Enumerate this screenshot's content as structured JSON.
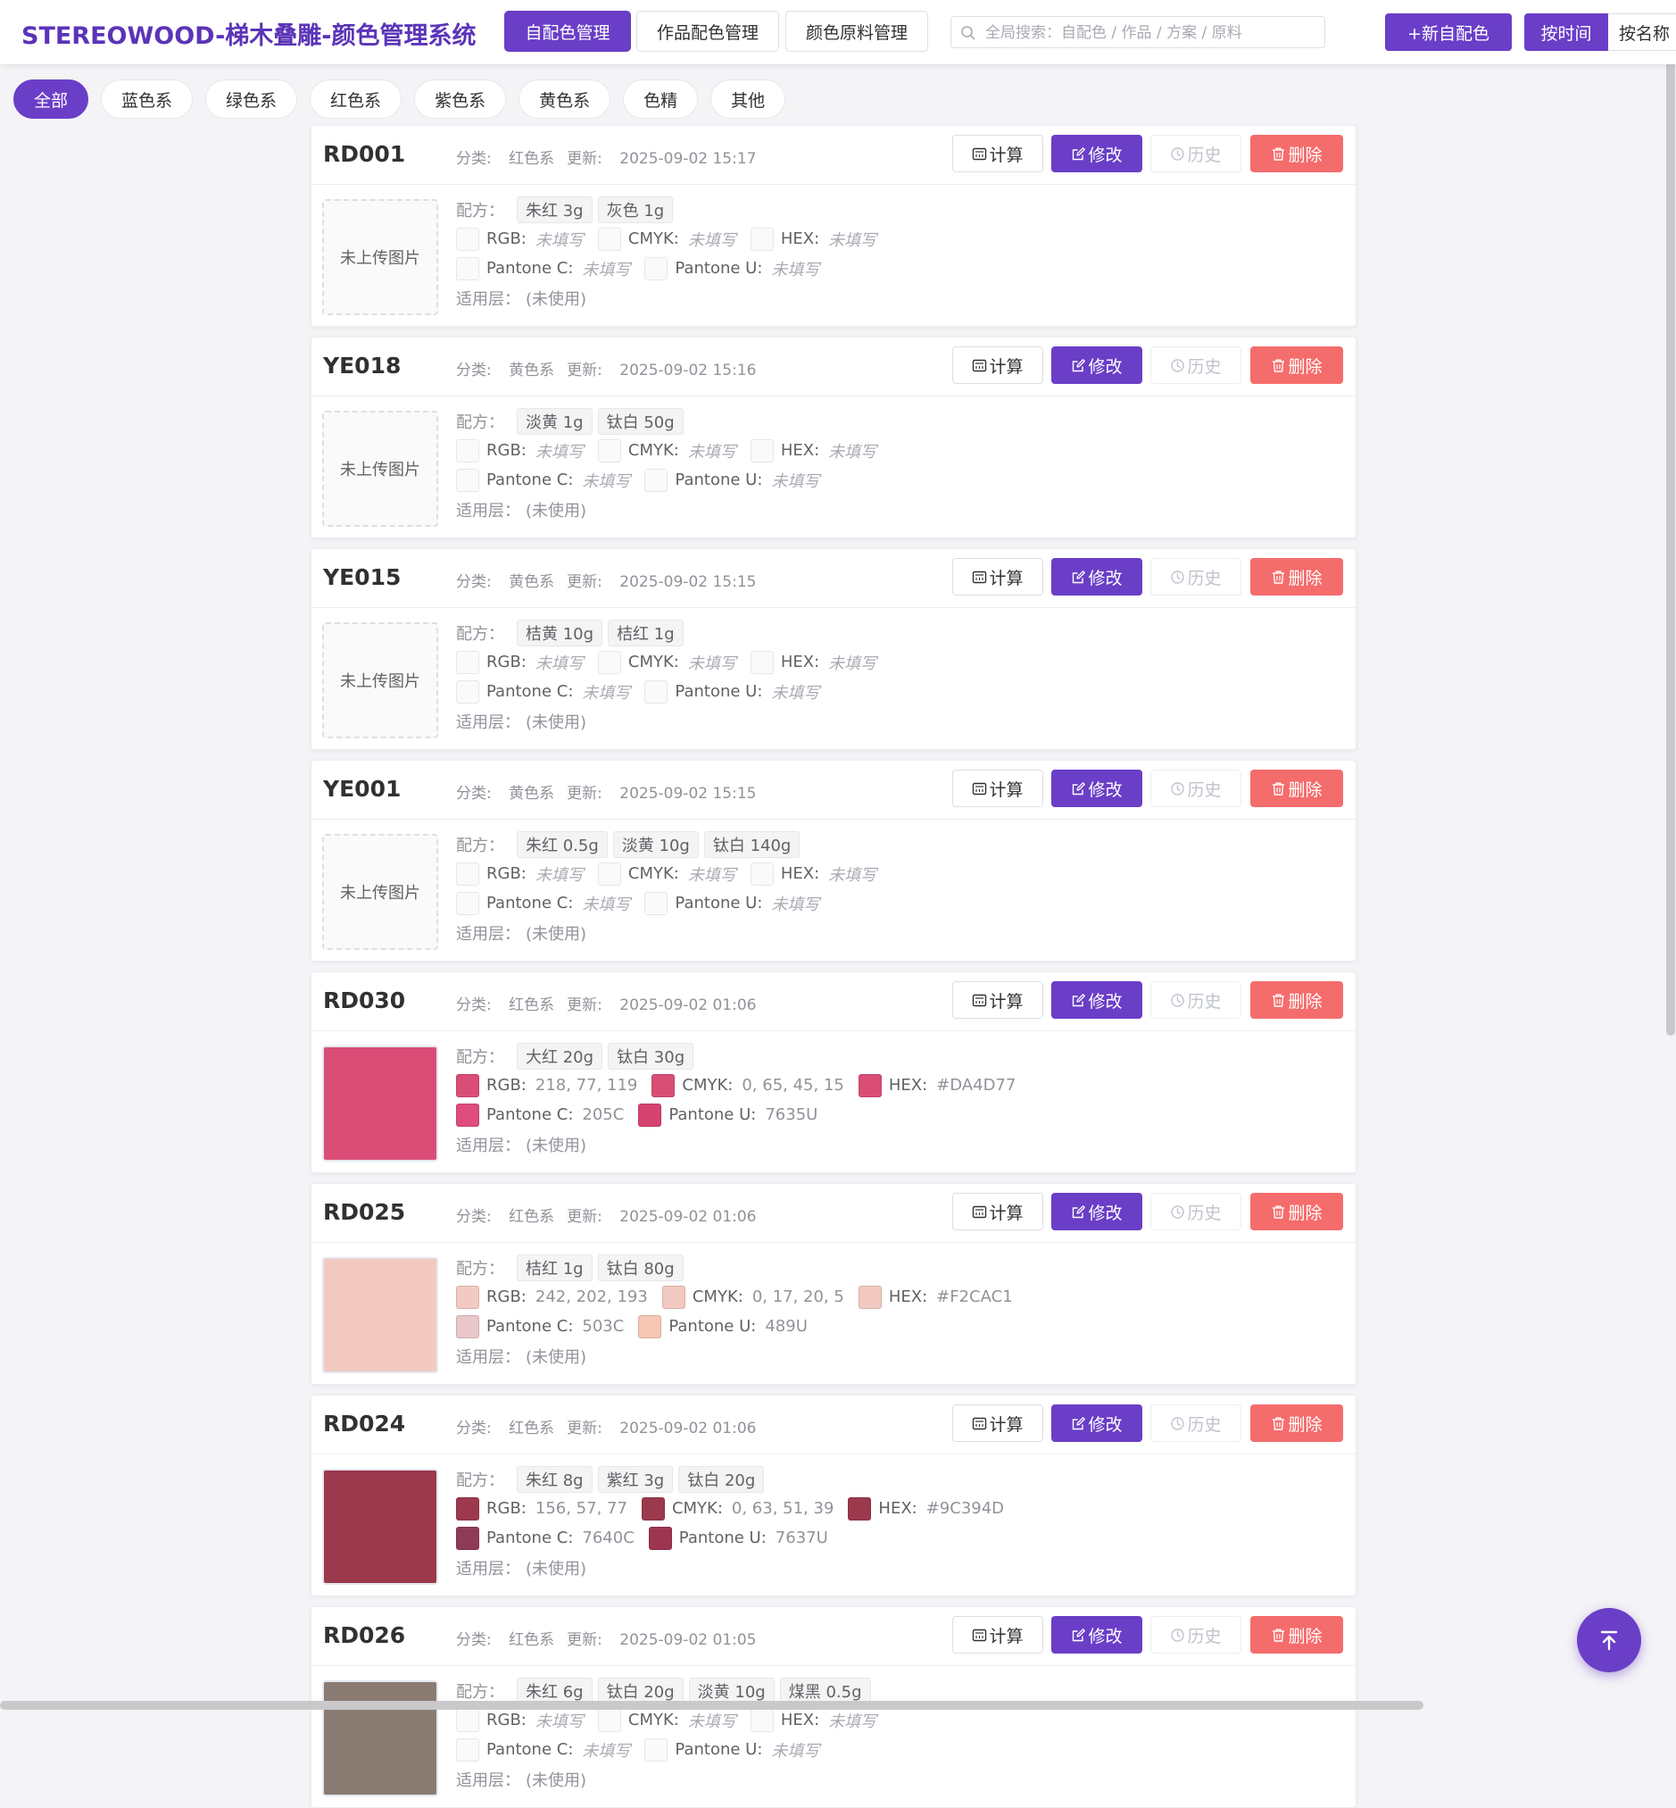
{
  "header": {
    "title": "STEREOWOOD-梯木叠雕-颜色管理系统",
    "tabs": [
      "自配色管理",
      "作品配色管理",
      "颜色原料管理"
    ],
    "search_placeholder": "全局搜索：自配色 / 作品 / 方案 / 原料",
    "new_button": "+新自配色",
    "sort_time": "按时间",
    "sort_name": "按名称"
  },
  "filters": [
    "全部",
    "蓝色系",
    "绿色系",
    "红色系",
    "紫色系",
    "黄色系",
    "色精",
    "其他"
  ],
  "labels": {
    "category": "分类:",
    "updated": "更新:",
    "calc": "计算",
    "edit": "修改",
    "history": "历史",
    "delete": "删除",
    "formula": "配方：",
    "layer": "适用层：",
    "no_image": "未上传图片",
    "unfilled": "未填写",
    "rgb": "RGB:",
    "cmyk": "CMYK:",
    "hex": "HEX:",
    "pantone_c": "Pantone C:",
    "pantone_u": "Pantone U:"
  },
  "colors": {
    "accent": "#6a3ec7",
    "danger": "#f56c6c"
  },
  "cards": [
    {
      "code": "RD001",
      "category": "红色系",
      "updated": "2025-09-02 15:17",
      "formula": [
        "朱红 3g",
        "灰色 1g"
      ],
      "layer": "(未使用)",
      "swatch": null,
      "rgb": null,
      "cmyk": null,
      "hex": null,
      "pantone_c": null,
      "pantone_u": null,
      "sw_rgb": null,
      "sw_cmyk": null,
      "sw_hex": null,
      "sw_pc": null,
      "sw_pu": null
    },
    {
      "code": "YE018",
      "category": "黄色系",
      "updated": "2025-09-02 15:16",
      "formula": [
        "淡黄 1g",
        "钛白 50g"
      ],
      "layer": "(未使用)",
      "swatch": null,
      "rgb": null,
      "cmyk": null,
      "hex": null,
      "pantone_c": null,
      "pantone_u": null,
      "sw_rgb": null,
      "sw_cmyk": null,
      "sw_hex": null,
      "sw_pc": null,
      "sw_pu": null
    },
    {
      "code": "YE015",
      "category": "黄色系",
      "updated": "2025-09-02 15:15",
      "formula": [
        "桔黄 10g",
        "桔红 1g"
      ],
      "layer": "(未使用)",
      "swatch": null,
      "rgb": null,
      "cmyk": null,
      "hex": null,
      "pantone_c": null,
      "pantone_u": null,
      "sw_rgb": null,
      "sw_cmyk": null,
      "sw_hex": null,
      "sw_pc": null,
      "sw_pu": null
    },
    {
      "code": "YE001",
      "category": "黄色系",
      "updated": "2025-09-02 15:15",
      "formula": [
        "朱红 0.5g",
        "淡黄 10g",
        "钛白 140g"
      ],
      "layer": "(未使用)",
      "swatch": null,
      "rgb": null,
      "cmyk": null,
      "hex": null,
      "pantone_c": null,
      "pantone_u": null,
      "sw_rgb": null,
      "sw_cmyk": null,
      "sw_hex": null,
      "sw_pc": null,
      "sw_pu": null
    },
    {
      "code": "RD030",
      "category": "红色系",
      "updated": "2025-09-02 01:06",
      "formula": [
        "大红 20g",
        "钛白 30g"
      ],
      "layer": "(未使用)",
      "swatch": "#DA4D77",
      "rgb": "218, 77, 119",
      "cmyk": "0, 65, 45, 15",
      "hex": "#DA4D77",
      "pantone_c": "205C",
      "pantone_u": "7635U",
      "sw_rgb": "#DA4D77",
      "sw_cmyk": "#D84F75",
      "sw_hex": "#DA4D77",
      "sw_pc": "#DE4D7C",
      "sw_pu": "#D6426F"
    },
    {
      "code": "RD025",
      "category": "红色系",
      "updated": "2025-09-02 01:06",
      "formula": [
        "桔红 1g",
        "钛白 80g"
      ],
      "layer": "(未使用)",
      "swatch": "#F2CAC1",
      "rgb": "242, 202, 193",
      "cmyk": "0, 17, 20, 5",
      "hex": "#F2CAC1",
      "pantone_c": "503C",
      "pantone_u": "489U",
      "sw_rgb": "#F2CAC1",
      "sw_cmyk": "#F2C9C1",
      "sw_hex": "#F2CAC1",
      "sw_pc": "#E9C6C8",
      "sw_pu": "#F5C7B4"
    },
    {
      "code": "RD024",
      "category": "红色系",
      "updated": "2025-09-02 01:06",
      "formula": [
        "朱红 8g",
        "紫红 3g",
        "钛白 20g"
      ],
      "layer": "(未使用)",
      "swatch": "#9C394D",
      "rgb": "156, 57, 77",
      "cmyk": "0, 63, 51, 39",
      "hex": "#9C394D",
      "pantone_c": "7640C",
      "pantone_u": "7637U",
      "sw_rgb": "#9C394D",
      "sw_cmyk": "#9C394C",
      "sw_hex": "#9C394D",
      "sw_pc": "#8F3B56",
      "sw_pu": "#9E3550"
    },
    {
      "code": "RD026",
      "category": "红色系",
      "updated": "2025-09-02 01:05",
      "formula": [
        "朱红 6g",
        "钛白 20g",
        "淡黄 10g",
        "煤黑 0.5g"
      ],
      "layer": "(未使用)",
      "swatch": "#8A7B72",
      "rgb": null,
      "cmyk": null,
      "hex": null,
      "pantone_c": null,
      "pantone_u": null,
      "sw_rgb": null,
      "sw_cmyk": null,
      "sw_hex": null,
      "sw_pc": null,
      "sw_pu": null
    }
  ]
}
